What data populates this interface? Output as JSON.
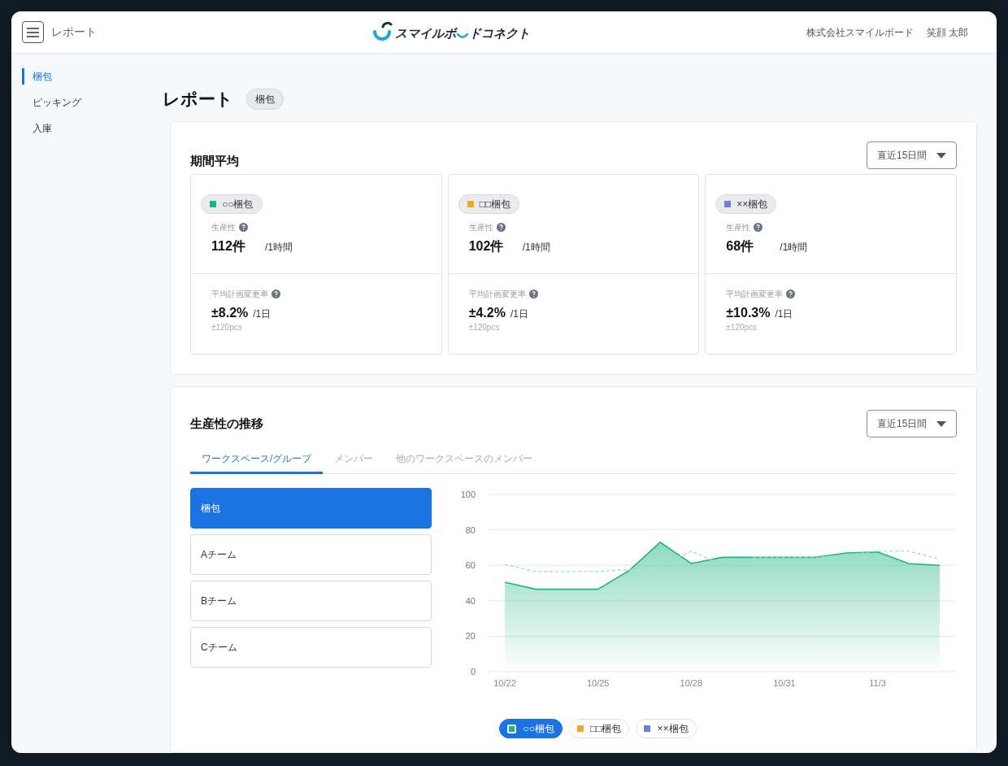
{
  "header": {
    "page_title": "レポート",
    "logo": {
      "text_before": "スマイルボ",
      "text_after": "ドコネクト"
    },
    "company": "株式会社スマイルボード",
    "user": "笑顔 太郎"
  },
  "sidebar": {
    "items": [
      {
        "label": "梱包",
        "selected": true
      },
      {
        "label": "ピッキング",
        "selected": false
      },
      {
        "label": "入庫",
        "selected": false
      }
    ]
  },
  "page": {
    "title": "レポート",
    "badge": "梱包"
  },
  "summary": {
    "title": "期間平均",
    "dropdown": "直近15日間",
    "items": [
      {
        "name": "○○梱包",
        "color": "#1cb585",
        "productivity_label": "生産性",
        "productivity_value": "112件",
        "productivity_unit": "/1時間",
        "change_label": "平均計画変更率",
        "change_value": "±8.2%",
        "change_unit": "/1日",
        "change_sub": "±120pcs"
      },
      {
        "name": "□□梱包",
        "color": "#f0a81c",
        "productivity_label": "生産性",
        "productivity_value": "102件",
        "productivity_unit": "/1時間",
        "change_label": "平均計画変更率",
        "change_value": "±4.2%",
        "change_unit": "/1日",
        "change_sub": "±120pcs"
      },
      {
        "name": "××梱包",
        "color": "#6f7fd6",
        "productivity_label": "生産性",
        "productivity_value": "68件",
        "productivity_unit": "/1時間",
        "change_label": "平均計画変更率",
        "change_value": "±10.3%",
        "change_unit": "/1日",
        "change_sub": "±120pcs"
      }
    ]
  },
  "trend": {
    "title": "生産性の推移",
    "dropdown": "直近15日間",
    "tabs": [
      {
        "label": "ワークスペース/グループ",
        "selected": true
      },
      {
        "label": "メンバー",
        "selected": false
      },
      {
        "label": "他のワークスペースのメンバー",
        "selected": false
      }
    ],
    "groups": [
      {
        "label": "梱包",
        "selected": true
      },
      {
        "label": "Aチーム",
        "selected": false
      },
      {
        "label": "Bチーム",
        "selected": false
      },
      {
        "label": "Cチーム",
        "selected": false
      }
    ],
    "chart_data": {
      "type": "area",
      "categories": [
        "10/22",
        null,
        null,
        "10/25",
        null,
        null,
        "10/28",
        null,
        null,
        "10/31",
        null,
        null,
        "11/3",
        null,
        null
      ],
      "ylim": [
        0,
        100
      ],
      "grid": true,
      "yticks": [
        0,
        20,
        40,
        60,
        80,
        100
      ],
      "series": [
        {
          "type": "area",
          "color": "#1cb585",
          "values": [
            50.5,
            46.5,
            46.5,
            46.5,
            57,
            73,
            61,
            64.5,
            64.5,
            64.5,
            64.5,
            67,
            67.5,
            61,
            60
          ]
        },
        {
          "type": "line",
          "line_style": "dashed",
          "color": "#8fdcc3",
          "values": [
            60.5,
            56.5,
            56.5,
            56.5,
            57.5,
            60,
            68,
            60.5,
            64.5,
            64.5,
            64.5,
            66,
            68,
            68,
            63.5
          ]
        }
      ]
    },
    "legend": [
      {
        "label": "○○梱包",
        "color": "#1cb585",
        "selected": true
      },
      {
        "label": "□□梱包",
        "color": "#f0a81c",
        "selected": false
      },
      {
        "label": "××梱包",
        "color": "#6f7fd6",
        "selected": false
      }
    ]
  }
}
